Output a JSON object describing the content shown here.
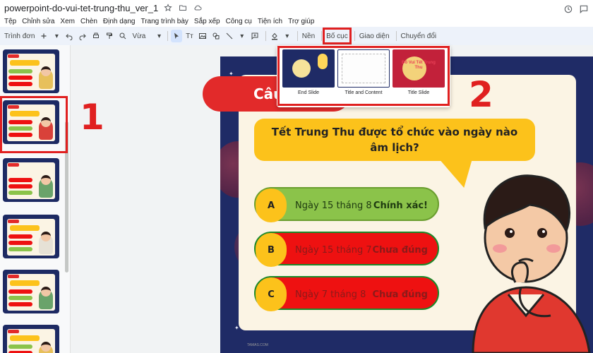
{
  "titlebar": {
    "title": "powerpoint-do-vui-tet-trung-thu_ver_1",
    "star_icon": "star-icon",
    "folder_icon": "move-folder-icon",
    "cloud_icon": "cloud-status-icon"
  },
  "menu": [
    "Tệp",
    "Chỉnh sửa",
    "Xem",
    "Chèn",
    "Định dạng",
    "Trang trình bày",
    "Sắp xếp",
    "Công cụ",
    "Tiện ích",
    "Trợ giúp"
  ],
  "toolbar": {
    "slideshow_label": "Trình đơn",
    "zoom_label": "Vừa",
    "background_label": "Nền",
    "layout_label": "Bố cục",
    "theme_label": "Giao diện",
    "transition_label": "Chuyển đổi"
  },
  "layouts": [
    {
      "label": "End Slide"
    },
    {
      "label": "Title and Content"
    },
    {
      "label": "Title Slide"
    }
  ],
  "layout_preview_title": "Đố Vui Tết Trung Thu",
  "slide": {
    "tab_label": "Câu",
    "question": "Tết Trung Thu được tổ chức vào ngày nào âm lịch?",
    "answers": [
      {
        "letter": "A",
        "text": "Ngày 15 tháng 8",
        "result": "Chính xác!"
      },
      {
        "letter": "B",
        "text": "Ngày 15 tháng 7",
        "result": "Chưa đúng"
      },
      {
        "letter": "C",
        "text": "Ngày 7 tháng 8",
        "result": "Chưa đúng"
      }
    ],
    "watermark": "TAMAS.COM"
  },
  "annotations": {
    "step1": "1",
    "step2": "2"
  },
  "colors": {
    "highlight_red": "#e02020",
    "slide_navy": "#1f2b66",
    "question_yellow": "#fcc21b",
    "correct_green": "#8bc34a",
    "wrong_red": "#ee1111"
  }
}
